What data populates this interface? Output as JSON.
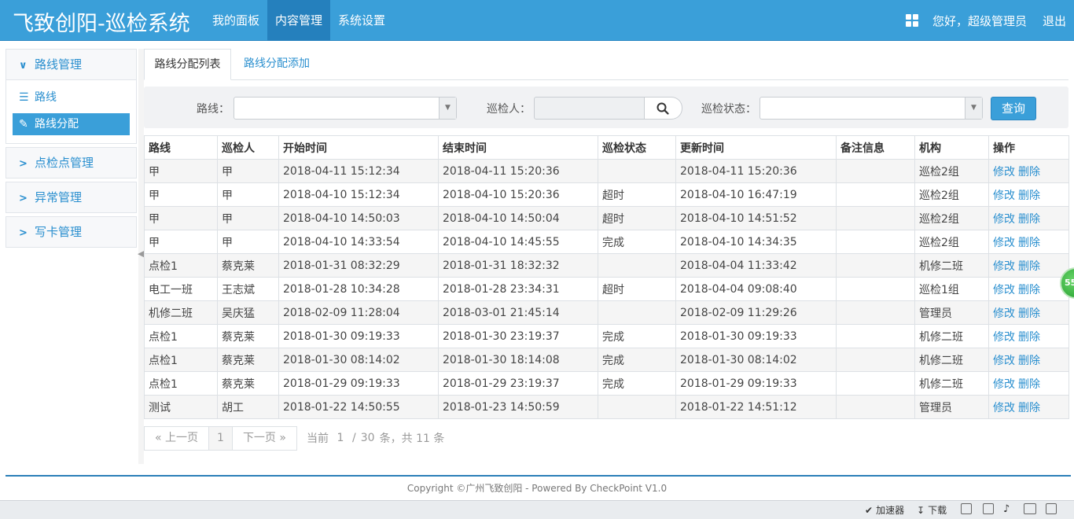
{
  "header": {
    "brand": "飞致创阳-巡检系统",
    "nav": [
      "我的面板",
      "内容管理",
      "系统设置"
    ],
    "active_nav": "内容管理",
    "greeting": "您好，超级管理员",
    "logout": "退出"
  },
  "sidebar": {
    "groups": [
      {
        "title": "路线管理",
        "expanded": true,
        "items": [
          {
            "label": "路线",
            "icon": "list-icon",
            "active": false
          },
          {
            "label": "路线分配",
            "icon": "pencil-icon",
            "active": true
          }
        ]
      },
      {
        "title": "点检点管理",
        "expanded": false
      },
      {
        "title": "异常管理",
        "expanded": false
      },
      {
        "title": "写卡管理",
        "expanded": false
      }
    ]
  },
  "tabs": {
    "list": "路线分配列表",
    "add": "路线分配添加"
  },
  "filter": {
    "route_label": "路线：",
    "inspector_label": "巡检人：",
    "status_label": "巡检状态：",
    "query_button": "查询"
  },
  "table": {
    "columns": [
      "路线",
      "巡检人",
      "开始时间",
      "结束时间",
      "巡检状态",
      "更新时间",
      "备注信息",
      "机构",
      "操作"
    ],
    "rows": [
      [
        "甲",
        "甲",
        "2018-04-11 15:12:34",
        "2018-04-11 15:20:36",
        "",
        "2018-04-11 15:20:36",
        "",
        "巡检2组"
      ],
      [
        "甲",
        "甲",
        "2018-04-10 15:12:34",
        "2018-04-10 15:20:36",
        "超时",
        "2018-04-10 16:47:19",
        "",
        "巡检2组"
      ],
      [
        "甲",
        "甲",
        "2018-04-10 14:50:03",
        "2018-04-10 14:50:04",
        "超时",
        "2018-04-10 14:51:52",
        "",
        "巡检2组"
      ],
      [
        "甲",
        "甲",
        "2018-04-10 14:33:54",
        "2018-04-10 14:45:55",
        "完成",
        "2018-04-10 14:34:35",
        "",
        "巡检2组"
      ],
      [
        "点检1",
        "蔡克莱",
        "2018-01-31 08:32:29",
        "2018-01-31 18:32:32",
        "",
        "2018-04-04 11:33:42",
        "",
        "机修二班"
      ],
      [
        "电工一班",
        "王志斌",
        "2018-01-28 10:34:28",
        "2018-01-28 23:34:31",
        "超时",
        "2018-04-04 09:08:40",
        "",
        "巡检1组"
      ],
      [
        "机修二班",
        "吴庆猛",
        "2018-02-09 11:28:04",
        "2018-03-01 21:45:14",
        "",
        "2018-02-09 11:29:26",
        "",
        "管理员"
      ],
      [
        "点检1",
        "蔡克莱",
        "2018-01-30 09:19:33",
        "2018-01-30 23:19:37",
        "完成",
        "2018-01-30 09:19:33",
        "",
        "机修二班"
      ],
      [
        "点检1",
        "蔡克莱",
        "2018-01-30 08:14:02",
        "2018-01-30 18:14:08",
        "完成",
        "2018-01-30 08:14:02",
        "",
        "机修二班"
      ],
      [
        "点检1",
        "蔡克莱",
        "2018-01-29 09:19:33",
        "2018-01-29 23:19:37",
        "完成",
        "2018-01-29 09:19:33",
        "",
        "机修二班"
      ],
      [
        "测试",
        "胡工",
        "2018-01-22 14:50:55",
        "2018-01-23 14:50:59",
        "",
        "2018-01-22 14:51:12",
        "",
        "管理员"
      ]
    ],
    "edit_label": "修改",
    "delete_label": "删除"
  },
  "pager": {
    "prev": "« 上一页",
    "current": "1",
    "next": "下一页 »",
    "info_prefix": "当前",
    "page": "1",
    "slash": "/",
    "page_size": "30",
    "info_suffix": "条，共 11 条"
  },
  "footer": "Copyright ©广州飞致创阳 - Powered By CheckPoint V1.0",
  "statusbar": {
    "accelerator": "加速器",
    "download": "下载"
  },
  "float_ball": "55",
  "colors": {
    "header": "#3a9fd9",
    "nav_active": "#2580bd",
    "link": "#2a8fcf"
  }
}
